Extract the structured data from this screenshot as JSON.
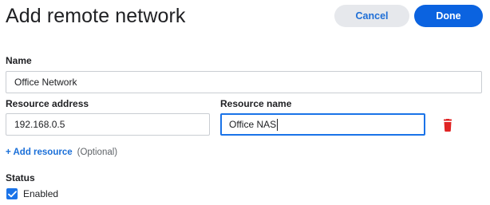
{
  "header": {
    "title": "Add remote network",
    "cancel_label": "Cancel",
    "done_label": "Done"
  },
  "form": {
    "name": {
      "label": "Name",
      "value": "Office Network"
    },
    "resource_address": {
      "label": "Resource address",
      "value": "192.168.0.5"
    },
    "resource_name": {
      "label": "Resource name",
      "value": "Office NAS"
    },
    "add_resource": {
      "label": "+ Add resource",
      "hint": "(Optional)"
    },
    "status": {
      "label": "Status",
      "checkbox_label": "Enabled",
      "checked": true
    }
  },
  "colors": {
    "primary": "#0b63e0",
    "link": "#1a6fd8",
    "danger": "#e02424",
    "secondary_bg": "#e6e8ec"
  },
  "icons": {
    "delete": "trash-icon",
    "checkbox": "checkmark-icon"
  }
}
